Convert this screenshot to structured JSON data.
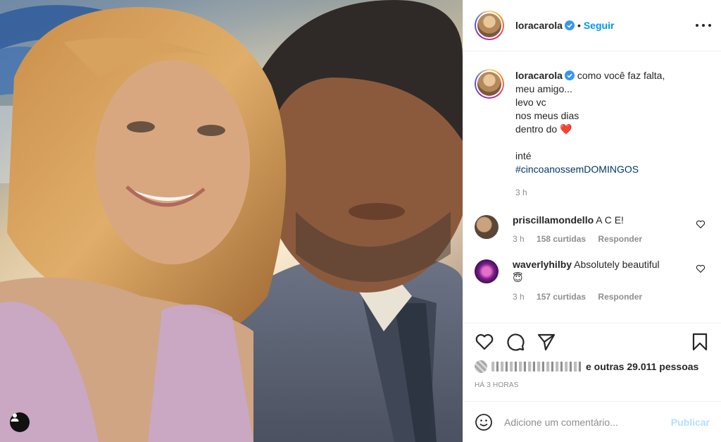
{
  "post": {
    "username": "loracarola",
    "follow_label": "Seguir",
    "dot": "•",
    "caption": {
      "username": "loracarola",
      "lines": [
        "como você faz falta,",
        "meu amigo...",
        "levo vc",
        "nos meus dias",
        "dentro do"
      ],
      "heart_emoji": "❤️",
      "signoff": "inté",
      "hashtag": "#cincoanossemDOMINGOS",
      "time": "3 h"
    },
    "comments": [
      {
        "username": "priscillamondello",
        "text": "A C E!",
        "time": "3 h",
        "likes": "158 curtidas",
        "reply": "Responder",
        "avatar_color": "#6d5a4c"
      },
      {
        "username": "waverlyhilby",
        "text": "Absolutely beautiful",
        "emoji": "😇",
        "time": "3 h",
        "likes": "157 curtidas",
        "reply": "Responder",
        "avatar_color": "#9a2fa8"
      }
    ],
    "likes_text": "e outras 29.011 pessoas",
    "date": "HÁ 3 HORAS",
    "comment_placeholder": "Adicione um comentário...",
    "publish_label": "Publicar"
  },
  "colors": {
    "accent": "#0095f6",
    "hashtag": "#00376b",
    "muted": "#8e8e8e",
    "publish_disabled": "#b2dffc"
  }
}
